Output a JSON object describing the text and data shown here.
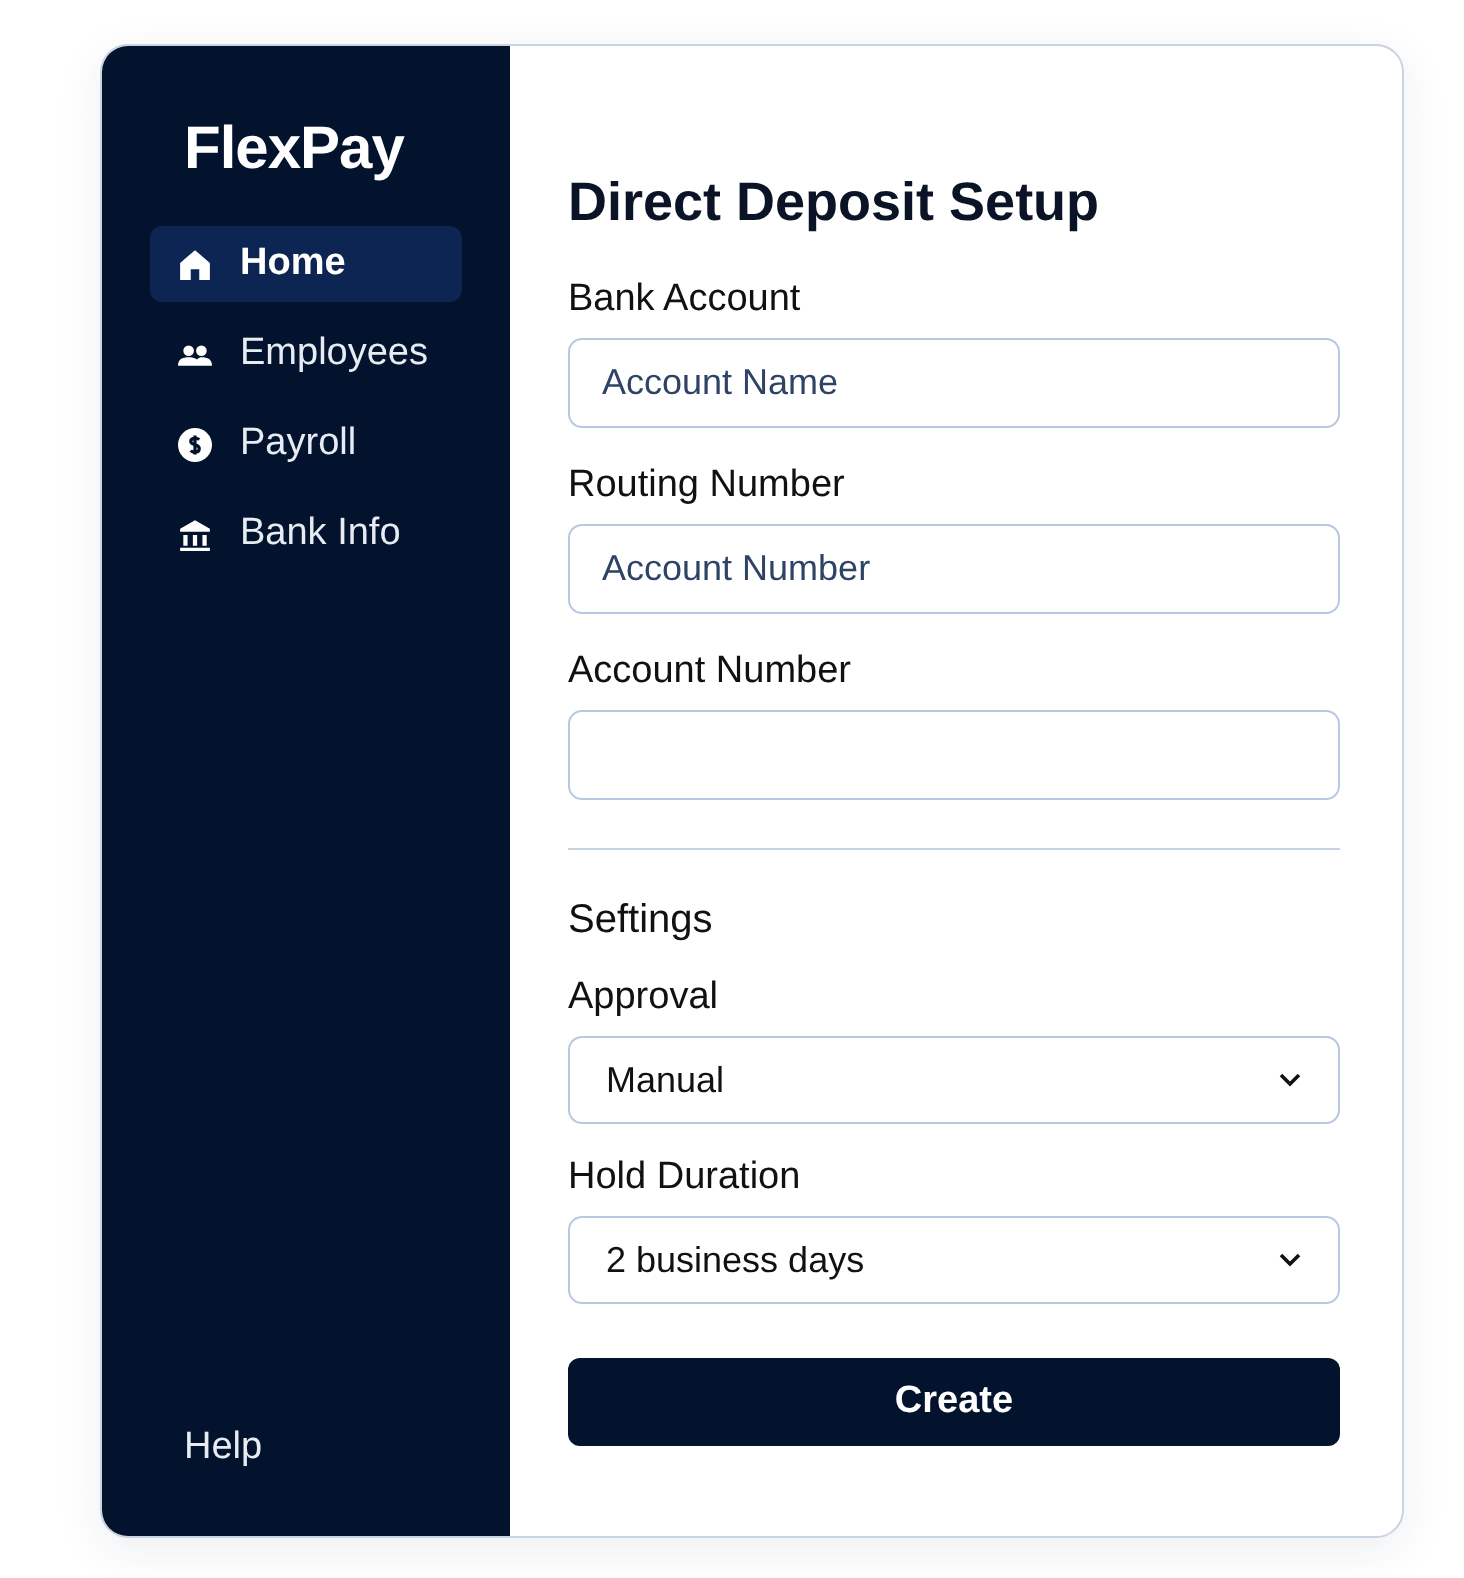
{
  "sidebar": {
    "logo": "FlexPay",
    "items": [
      {
        "label": "Home",
        "selected": true
      },
      {
        "label": "Employees",
        "selected": false
      },
      {
        "label": "Payroll",
        "selected": false
      },
      {
        "label": "Bank Info",
        "selected": false
      }
    ],
    "footer_link": "Help"
  },
  "form": {
    "title": "Direct Deposit Setup",
    "fields": [
      {
        "label": "Bank Account",
        "placeholder": "Account Name"
      },
      {
        "label": "Routing Number",
        "placeholder": "Account Number"
      },
      {
        "label": "Account Number"
      }
    ],
    "section_title": "Seftings",
    "selects": [
      {
        "label": "Approval",
        "value": "Manual"
      },
      {
        "label": "Hold Duration",
        "value": "2 business days"
      }
    ],
    "submit": "Create"
  }
}
